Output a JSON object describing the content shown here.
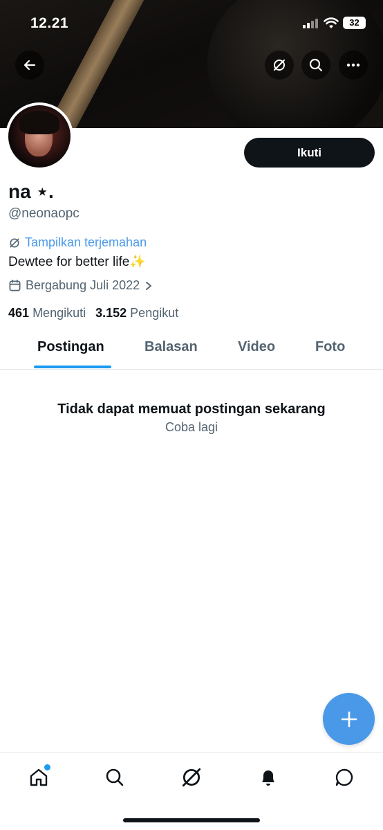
{
  "status_bar": {
    "time": "12.21",
    "battery": "32"
  },
  "header": {
    "back_icon": "arrow-left-icon",
    "grok_icon": "grok-icon",
    "search_icon": "search-icon",
    "more_icon": "more-icon"
  },
  "profile": {
    "follow_label": "Ikuti",
    "name": "na ⋆.",
    "handle": "@neonaopc",
    "translate_label": "Tampilkan terjemahan",
    "bio": "Dewtee for better life✨",
    "joined": "Bergabung Juli 2022",
    "following_count": "461",
    "following_label": "Mengikuti",
    "followers_count": "3.152",
    "followers_label": "Pengikut"
  },
  "tabs": [
    {
      "label": "Postingan",
      "active": true
    },
    {
      "label": "Balasan",
      "active": false
    },
    {
      "label": "Video",
      "active": false
    },
    {
      "label": "Foto",
      "active": false
    }
  ],
  "content": {
    "error_title": "Tidak dapat memuat postingan sekarang",
    "retry_label": "Coba lagi"
  },
  "colors": {
    "accent": "#1d9bf0",
    "fab": "#4a99e9",
    "link": "#4a99e9",
    "button_dark": "#0f1419"
  },
  "bottom_nav": [
    "home-icon",
    "search-icon",
    "grok-icon",
    "notifications-icon",
    "messages-icon"
  ]
}
